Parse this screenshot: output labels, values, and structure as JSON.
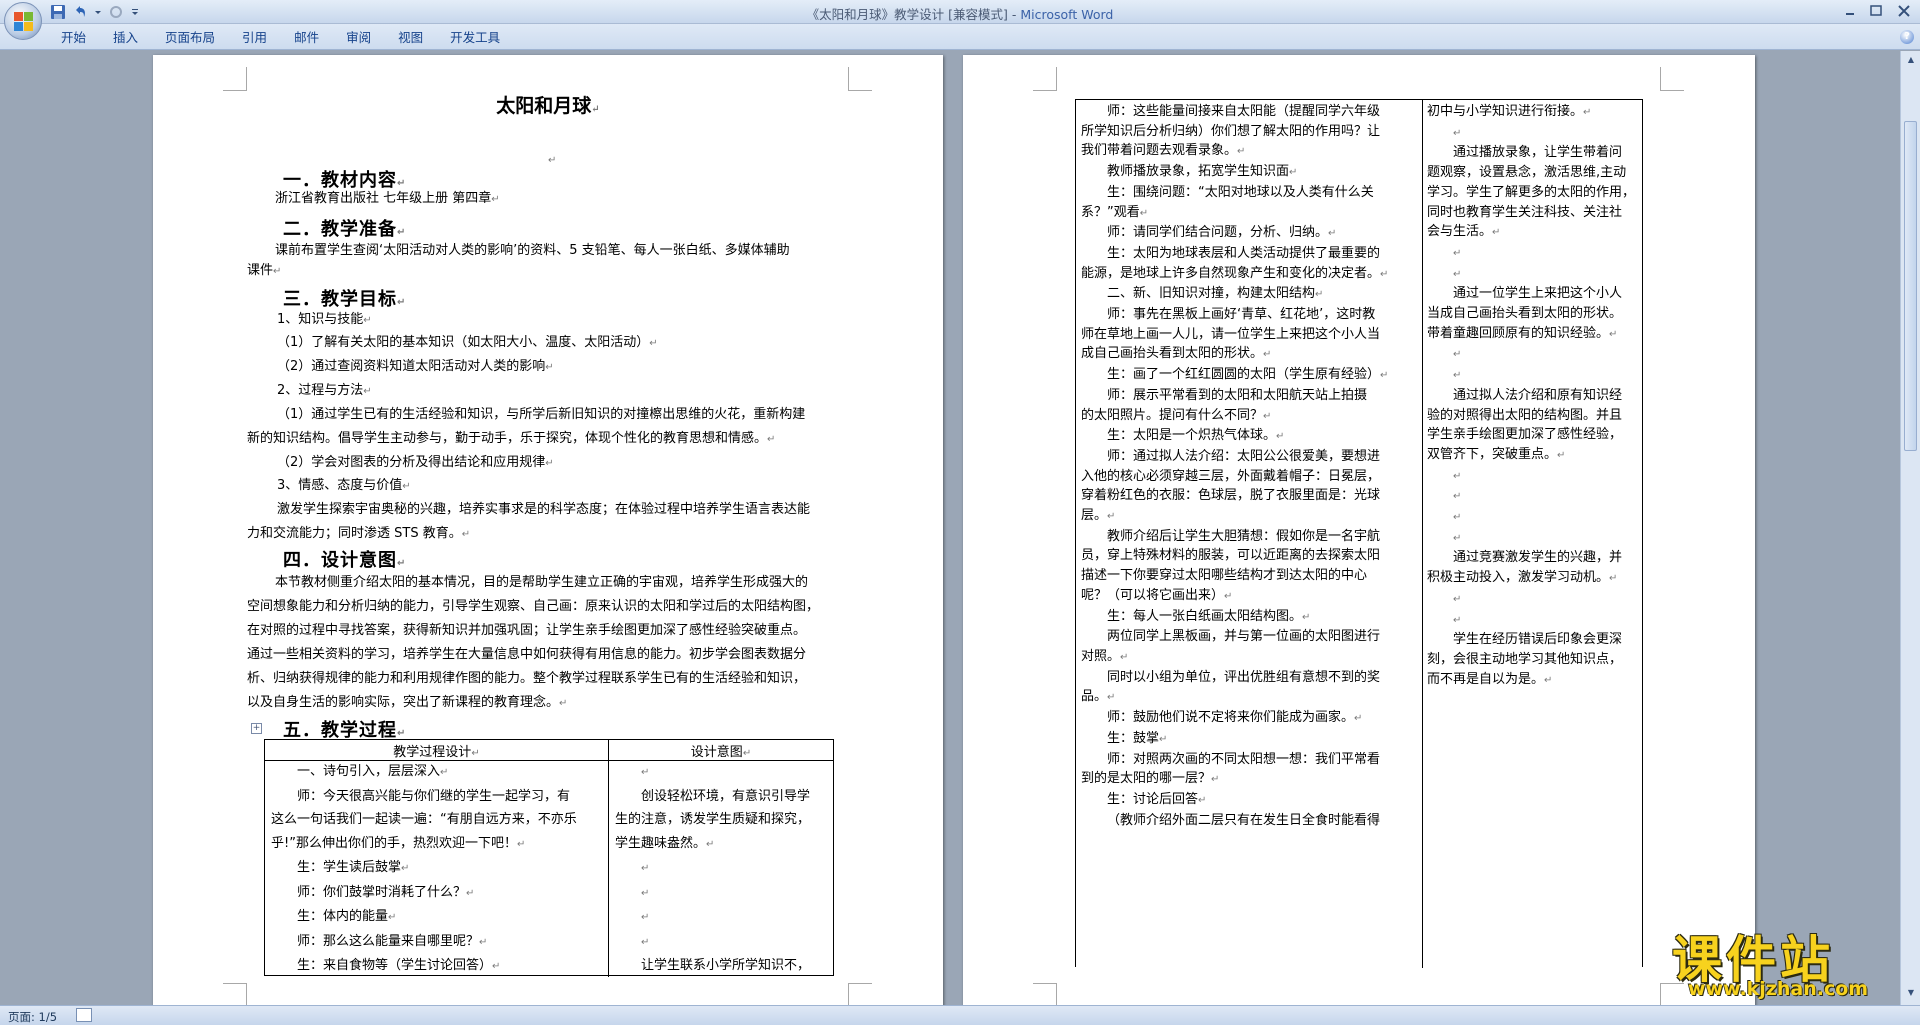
{
  "window": {
    "title": "《太阳和月球》教学设计 [兼容模式] - ",
    "app_name": "Microsoft Word"
  },
  "ribbon": {
    "tabs": [
      "开始",
      "插入",
      "页面布局",
      "引用",
      "邮件",
      "审阅",
      "视图",
      "开发工具"
    ]
  },
  "status": {
    "page_info": "页面: 1/5"
  },
  "page1": {
    "title": "太阳和月球",
    "sections": {
      "s1_heading": "一．教材内容",
      "s1_line": "浙江省教育出版社      七年级上册     第四章",
      "s2_heading": "二．教学准备",
      "s2_line1": "课前布置学生查阅‘太阳活动对人类的影响’的资料、5 支铅笔、每人一张白纸、多媒体辅助",
      "s2_line2": "课件",
      "s3_heading": "三．教学目标",
      "s3_lines": [
        "1、知识与技能",
        "（1）了解有关太阳的基本知识（如太阳大小、温度、太阳活动）",
        "（2）通过查阅资料知道太阳活动对人类的影响",
        "2、过程与方法",
        "（1）通过学生已有的生活经验和知识，与所学后新旧知识的对撞檫出思维的火花，重新构建",
        "新的知识结构。倡导学生主动参与，勤于动手，乐于探究，体现个性化的教育思想和情感。",
        "（2）学会对图表的分析及得出结论和应用规律",
        "3、情感、态度与价值",
        "激发学生探索宇宙奥秘的兴趣，培养实事求是的科学态度；在体验过程中培养学生语言表达能",
        "力和交流能力；同时渗透 STS 教育。"
      ],
      "s4_heading": "四．设计意图",
      "s4_lines": [
        "本节教材侧重介绍太阳的基本情况，目的是帮助学生建立正确的宇宙观，培养学生形成强大的",
        "空间想象能力和分析归纳的能力，引导学生观察、自己画：原来认识的太阳和学过后的太阳结构图，",
        "在对照的过程中寻找答案，获得新知识并加强巩固；让学生亲手绘图更加深了感性经验突破重点。",
        "通过一些相关资料的学习，培养学生在大量信息中如何获得有用信息的能力。初步学会图表数据分",
        "析、归纳获得规律的能力和利用规律作图的能力。整个教学过程联系学生已有的生活经验和知识，",
        "以及自身生活的影响实际，突出了新课程的教育理念。"
      ],
      "s5_heading": "五．教学过程"
    },
    "table": {
      "col1_header": "教学过程设计",
      "col2_header": "设计意图",
      "left_lines": [
        "一、诗句引入，层层深入",
        "师：今天很高兴能与你们继的学生一起学习，有",
        "这么一句话我们一起读一遍：“有朋自远方来，不亦乐",
        "乎!”那么伸出你们的手，热烈欢迎一下吧！",
        "生：学生读后鼓掌",
        "师：你们鼓掌时消耗了什么？",
        "生：体内的能量",
        "师：那么这么能量来自哪里呢？",
        "生：来自食物等（学生讨论回答）"
      ],
      "right_lines": [
        "",
        "创设轻松环境，有意识引导学",
        "生的注意，诱发学生质疑和探究，",
        "学生趣味盎然。",
        "",
        "",
        "",
        "",
        "让学生联系小学所学知识不，"
      ]
    }
  },
  "page2": {
    "left_lines": [
      "师：这些能量间接来自太阳能（提醒同学六年级",
      "所学知识后分析归纳）你们想了解太阳的作用吗？让",
      "我们带着问题去观看录象。",
      "教师播放录象，拓宽学生知识面",
      "生：围绕问题：“太阳对地球以及人类有什么关",
      "系？”观看",
      "师：请同学们结合问题，分析、归纳。",
      "生：太阳为地球表层和人类活动提供了最重要的",
      "能源，是地球上许多自然现象产生和变化的决定者。",
      "二、新、旧知识对撞，构建太阳结构",
      "师：事先在黑板上画好‘青草、红花地’，这时教",
      "师在草地上画一人儿，请一位学生上来把这个小人当",
      "成自己画抬头看到太阳的形状。",
      "生：画了一个红红圆圆的太阳（学生原有经验）",
      "师：展示平常看到的太阳和太阳航天站上拍摄",
      "的太阳照片。提问有什么不同？",
      "生：太阳是一个炽热气体球。",
      "师：通过拟人法介绍：太阳公公很爱美，要想进",
      "入他的核心必须穿越三层，外面戴着帽子：日冕层，",
      "穿着粉红色的衣服：色球层，脱了衣服里面是：光球",
      "层。",
      "教师介绍后让学生大胆猜想：假如你是一名宇航",
      "员，穿上特殊材料的服装，可以近距离的去探索太阳",
      "描述一下你要穿过太阳哪些结构才到达太阳的中心",
      "呢？（可以将它画出来）",
      "生：每人一张白纸画太阳结构图。",
      "两位同学上黑板画，并与第一位画的太阳图进行",
      "对照。",
      "同时以小组为单位，评出优胜组有意想不到的奖",
      "品。",
      "师：鼓励他们说不定将来你们能成为画家。",
      "生：鼓掌",
      "师：对照两次画的不同太阳想一想：我们平常看",
      "到的是太阳的哪一层？",
      "生：讨论后回答",
      "（教师介绍外面二层只有在发生日全食时能看得"
    ],
    "right_lines": [
      "初中与小学知识进行衔接。",
      "",
      "通过播放录象，让学生带着问",
      "题观察，设置悬念，激活思维,主动",
      "学习。学生了解更多的太阳的作用，",
      "同时也教育学生关注科技、关注社",
      "会与生活。",
      "",
      "",
      "通过一位学生上来把这个小人",
      "当成自己画抬头看到太阳的形状。",
      "带着童趣回顾原有的知识经验。",
      "",
      "",
      "通过拟人法介绍和原有知识经",
      "验的对照得出太阳的结构图。并且",
      "学生亲手绘图更加深了感性经验，",
      "双管齐下，突破重点。",
      "",
      "",
      "",
      "",
      "通过竞赛激发学生的兴趣，并",
      "积极主动投入，激发学习动机。",
      "",
      "",
      "学生在经历错误后印象会更深",
      "刻，会很主动地学习其他知识点，",
      "而不再是自以为是。"
    ]
  },
  "watermark": {
    "text": "课件站",
    "url": "www.kjzhan.com"
  },
  "icons": [
    "office-button-icon",
    "save-icon",
    "undo-icon",
    "redo-icon",
    "customize-qat-icon",
    "minimize-icon",
    "maximize-icon",
    "close-icon",
    "help-icon",
    "table-move-handle-icon",
    "proofing-icon",
    "scroll-up-icon",
    "scroll-down-icon"
  ]
}
